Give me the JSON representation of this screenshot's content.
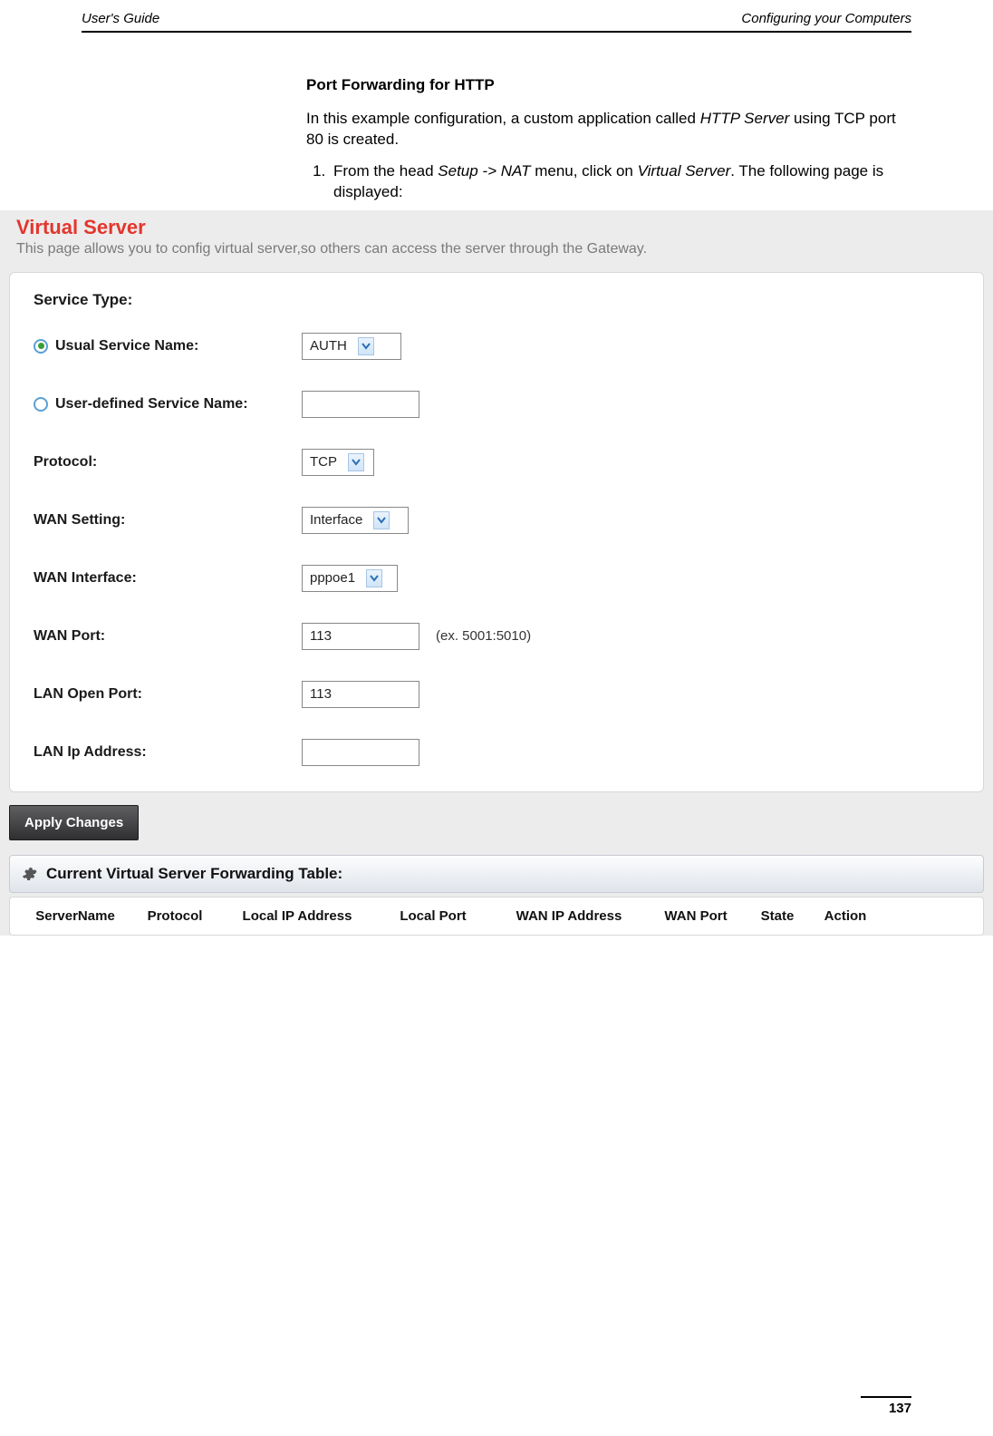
{
  "header": {
    "left": "User's Guide",
    "right": "Configuring your Computers"
  },
  "doc": {
    "title": "Port Forwarding for HTTP",
    "intro_1": "In this example configuration, a custom application called ",
    "intro_em": "HTTP Server",
    "intro_2": " using TCP port 80 is created.",
    "step1_a": "From the head ",
    "step1_em1": "Setup -> NAT",
    "step1_b": " menu, click on ",
    "step1_em2": "Virtual Server",
    "step1_c": ". The following page is displayed:"
  },
  "router": {
    "title": "Virtual Server",
    "subtitle": "This page allows you to config virtual server,so others can access the server through the Gateway.",
    "section": "Service Type:",
    "rows": {
      "usual_label": "Usual Service Name:",
      "usual_value": "AUTH",
      "userdef_label": "User-defined Service Name:",
      "userdef_value": "",
      "protocol_label": "Protocol:",
      "protocol_value": "TCP",
      "wan_setting_label": "WAN Setting:",
      "wan_setting_value": "Interface",
      "wan_iface_label": "WAN Interface:",
      "wan_iface_value": "pppoe1",
      "wan_port_label": "WAN Port:",
      "wan_port_value": "113",
      "wan_port_hint": "(ex. 5001:5010)",
      "lan_open_label": "LAN Open Port:",
      "lan_open_value": "113",
      "lan_ip_label": "LAN Ip Address:",
      "lan_ip_value": ""
    },
    "apply": "Apply Changes",
    "table": {
      "title": "Current Virtual Server Forwarding Table:",
      "cols": {
        "server": "ServerName",
        "protocol": "Protocol",
        "local_ip": "Local IP Address",
        "local_port": "Local Port",
        "wan_ip": "WAN IP Address",
        "wan_port": "WAN Port",
        "state": "State",
        "action": "Action"
      }
    }
  },
  "page_number": "137"
}
